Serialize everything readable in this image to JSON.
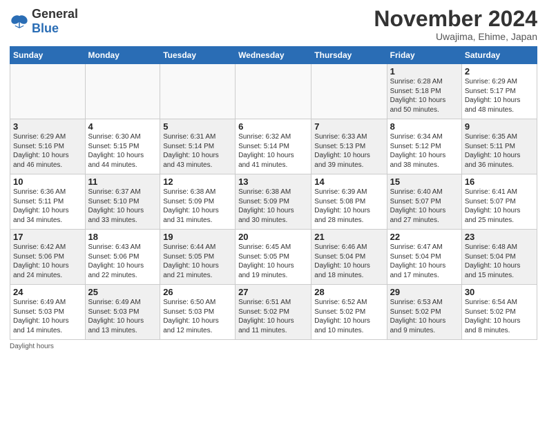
{
  "header": {
    "logo_general": "General",
    "logo_blue": "Blue",
    "month_title": "November 2024",
    "subtitle": "Uwajima, Ehime, Japan"
  },
  "footer_note": "Daylight hours",
  "columns": [
    "Sunday",
    "Monday",
    "Tuesday",
    "Wednesday",
    "Thursday",
    "Friday",
    "Saturday"
  ],
  "weeks": [
    [
      {
        "day": "",
        "info": "",
        "empty": true
      },
      {
        "day": "",
        "info": "",
        "empty": true
      },
      {
        "day": "",
        "info": "",
        "empty": true
      },
      {
        "day": "",
        "info": "",
        "empty": true
      },
      {
        "day": "",
        "info": "",
        "empty": true
      },
      {
        "day": "1",
        "info": "Sunrise: 6:28 AM\nSunset: 5:18 PM\nDaylight: 10 hours\nand 50 minutes.",
        "shaded": true
      },
      {
        "day": "2",
        "info": "Sunrise: 6:29 AM\nSunset: 5:17 PM\nDaylight: 10 hours\nand 48 minutes.",
        "shaded": false
      }
    ],
    [
      {
        "day": "3",
        "info": "Sunrise: 6:29 AM\nSunset: 5:16 PM\nDaylight: 10 hours\nand 46 minutes.",
        "shaded": true
      },
      {
        "day": "4",
        "info": "Sunrise: 6:30 AM\nSunset: 5:15 PM\nDaylight: 10 hours\nand 44 minutes.",
        "shaded": false
      },
      {
        "day": "5",
        "info": "Sunrise: 6:31 AM\nSunset: 5:14 PM\nDaylight: 10 hours\nand 43 minutes.",
        "shaded": true
      },
      {
        "day": "6",
        "info": "Sunrise: 6:32 AM\nSunset: 5:14 PM\nDaylight: 10 hours\nand 41 minutes.",
        "shaded": false
      },
      {
        "day": "7",
        "info": "Sunrise: 6:33 AM\nSunset: 5:13 PM\nDaylight: 10 hours\nand 39 minutes.",
        "shaded": true
      },
      {
        "day": "8",
        "info": "Sunrise: 6:34 AM\nSunset: 5:12 PM\nDaylight: 10 hours\nand 38 minutes.",
        "shaded": false
      },
      {
        "day": "9",
        "info": "Sunrise: 6:35 AM\nSunset: 5:11 PM\nDaylight: 10 hours\nand 36 minutes.",
        "shaded": true
      }
    ],
    [
      {
        "day": "10",
        "info": "Sunrise: 6:36 AM\nSunset: 5:11 PM\nDaylight: 10 hours\nand 34 minutes.",
        "shaded": false
      },
      {
        "day": "11",
        "info": "Sunrise: 6:37 AM\nSunset: 5:10 PM\nDaylight: 10 hours\nand 33 minutes.",
        "shaded": true
      },
      {
        "day": "12",
        "info": "Sunrise: 6:38 AM\nSunset: 5:09 PM\nDaylight: 10 hours\nand 31 minutes.",
        "shaded": false
      },
      {
        "day": "13",
        "info": "Sunrise: 6:38 AM\nSunset: 5:09 PM\nDaylight: 10 hours\nand 30 minutes.",
        "shaded": true
      },
      {
        "day": "14",
        "info": "Sunrise: 6:39 AM\nSunset: 5:08 PM\nDaylight: 10 hours\nand 28 minutes.",
        "shaded": false
      },
      {
        "day": "15",
        "info": "Sunrise: 6:40 AM\nSunset: 5:07 PM\nDaylight: 10 hours\nand 27 minutes.",
        "shaded": true
      },
      {
        "day": "16",
        "info": "Sunrise: 6:41 AM\nSunset: 5:07 PM\nDaylight: 10 hours\nand 25 minutes.",
        "shaded": false
      }
    ],
    [
      {
        "day": "17",
        "info": "Sunrise: 6:42 AM\nSunset: 5:06 PM\nDaylight: 10 hours\nand 24 minutes.",
        "shaded": true
      },
      {
        "day": "18",
        "info": "Sunrise: 6:43 AM\nSunset: 5:06 PM\nDaylight: 10 hours\nand 22 minutes.",
        "shaded": false
      },
      {
        "day": "19",
        "info": "Sunrise: 6:44 AM\nSunset: 5:05 PM\nDaylight: 10 hours\nand 21 minutes.",
        "shaded": true
      },
      {
        "day": "20",
        "info": "Sunrise: 6:45 AM\nSunset: 5:05 PM\nDaylight: 10 hours\nand 19 minutes.",
        "shaded": false
      },
      {
        "day": "21",
        "info": "Sunrise: 6:46 AM\nSunset: 5:04 PM\nDaylight: 10 hours\nand 18 minutes.",
        "shaded": true
      },
      {
        "day": "22",
        "info": "Sunrise: 6:47 AM\nSunset: 5:04 PM\nDaylight: 10 hours\nand 17 minutes.",
        "shaded": false
      },
      {
        "day": "23",
        "info": "Sunrise: 6:48 AM\nSunset: 5:04 PM\nDaylight: 10 hours\nand 15 minutes.",
        "shaded": true
      }
    ],
    [
      {
        "day": "24",
        "info": "Sunrise: 6:49 AM\nSunset: 5:03 PM\nDaylight: 10 hours\nand 14 minutes.",
        "shaded": false
      },
      {
        "day": "25",
        "info": "Sunrise: 6:49 AM\nSunset: 5:03 PM\nDaylight: 10 hours\nand 13 minutes.",
        "shaded": true
      },
      {
        "day": "26",
        "info": "Sunrise: 6:50 AM\nSunset: 5:03 PM\nDaylight: 10 hours\nand 12 minutes.",
        "shaded": false
      },
      {
        "day": "27",
        "info": "Sunrise: 6:51 AM\nSunset: 5:02 PM\nDaylight: 10 hours\nand 11 minutes.",
        "shaded": true
      },
      {
        "day": "28",
        "info": "Sunrise: 6:52 AM\nSunset: 5:02 PM\nDaylight: 10 hours\nand 10 minutes.",
        "shaded": false
      },
      {
        "day": "29",
        "info": "Sunrise: 6:53 AM\nSunset: 5:02 PM\nDaylight: 10 hours\nand 9 minutes.",
        "shaded": true
      },
      {
        "day": "30",
        "info": "Sunrise: 6:54 AM\nSunset: 5:02 PM\nDaylight: 10 hours\nand 8 minutes.",
        "shaded": false
      }
    ]
  ]
}
